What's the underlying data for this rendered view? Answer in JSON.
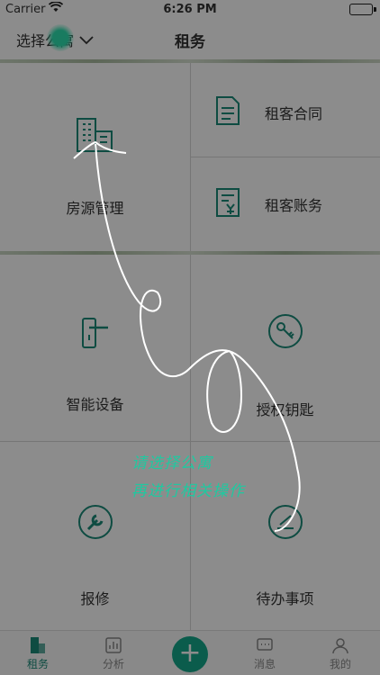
{
  "status": {
    "carrier": "Carrier",
    "time": "6:26 PM"
  },
  "nav": {
    "select_label": "选择公寓",
    "title": "租务"
  },
  "grid": {
    "house": "房源管理",
    "contract": "租客合同",
    "account": "租客账务",
    "device": "智能设备",
    "key": "授权钥匙",
    "repair": "报修",
    "todo": "待办事项"
  },
  "tabs": {
    "rent": "租务",
    "analysis": "分析",
    "message": "消息",
    "mine": "我的"
  },
  "guide": {
    "line1": "请选择公寓",
    "line2": "再进行相关操作"
  },
  "colors": {
    "accent": "#14a88a",
    "overlay": "rgba(0,0,0,0.45)",
    "guide_text": "#1fc9a0"
  }
}
